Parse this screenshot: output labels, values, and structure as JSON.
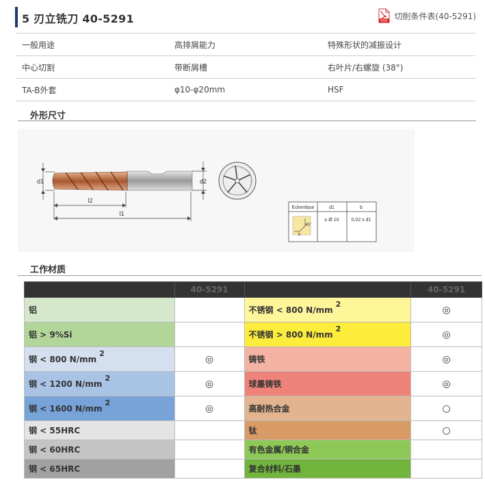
{
  "header": {
    "title": "5 刃立铣刀 40-5291",
    "pdf_link": "切削条件表(40-5291)",
    "pdf_icon": "pdf-icon"
  },
  "spec_rows": [
    [
      "一般用途",
      "高排屑能力",
      "特殊形状的减振设计"
    ],
    [
      "中心切割",
      "带断屑槽",
      "右叶片/右螺旋 (38°)"
    ],
    [
      "TA-B外套",
      "φ10-φ20mm",
      "HSF"
    ]
  ],
  "sections": {
    "dimensions": "外形尺寸",
    "materials": "工作材质"
  },
  "drawing": {
    "labels": {
      "d1": "d1",
      "d2": "d2",
      "l1": "l1",
      "l2": "l2"
    },
    "table": {
      "headers": [
        "Eckenfase",
        "d1",
        "b"
      ],
      "row": [
        "≥ Ø 10",
        "0,02 x d1"
      ],
      "angle": "45°",
      "b": "b"
    }
  },
  "materials": {
    "col_header": "40-5291",
    "left": [
      {
        "name": "铝",
        "sup": "",
        "color": "#d5e8cb",
        "mark": ""
      },
      {
        "name": "铝 > 9%Si",
        "sup": "",
        "color": "#b2d59a",
        "mark": ""
      },
      {
        "name": "钢 < 800 N/mm",
        "sup": "2",
        "color": "#d4dff0",
        "mark": "◎"
      },
      {
        "name": "钢 < 1200 N/mm",
        "sup": "2",
        "color": "#a9c3e5",
        "mark": "◎"
      },
      {
        "name": "钢 < 1600 N/mm",
        "sup": "2",
        "color": "#77a3d8",
        "mark": "◎"
      },
      {
        "name": "钢 < 55HRC",
        "sup": "",
        "color": "#e4e4e4",
        "mark": ""
      },
      {
        "name": "钢 < 60HRC",
        "sup": "",
        "color": "#c4c4c4",
        "mark": ""
      },
      {
        "name": "钢 < 65HRC",
        "sup": "",
        "color": "#a1a1a1",
        "mark": ""
      }
    ],
    "right": [
      {
        "name": "不锈钢 < 800 N/mm",
        "sup": "2",
        "color": "#fff69a",
        "mark": "◎"
      },
      {
        "name": "不锈钢 > 800 N/mm",
        "sup": "2",
        "color": "#fcec3c",
        "mark": "◎"
      },
      {
        "name": "铸铁",
        "sup": "",
        "color": "#f3b2a2",
        "mark": "◎"
      },
      {
        "name": "球墨铸铁",
        "sup": "",
        "color": "#ee8479",
        "mark": "◎"
      },
      {
        "name": "高耐热合金",
        "sup": "",
        "color": "#e2b48f",
        "mark": "○"
      },
      {
        "name": "钛",
        "sup": "",
        "color": "#d89b66",
        "mark": "○"
      },
      {
        "name": "有色金属/铜合金",
        "sup": "",
        "color": "#8ec857",
        "mark": ""
      },
      {
        "name": "复合材料/石墨",
        "sup": "",
        "color": "#71b53d",
        "mark": ""
      }
    ]
  }
}
